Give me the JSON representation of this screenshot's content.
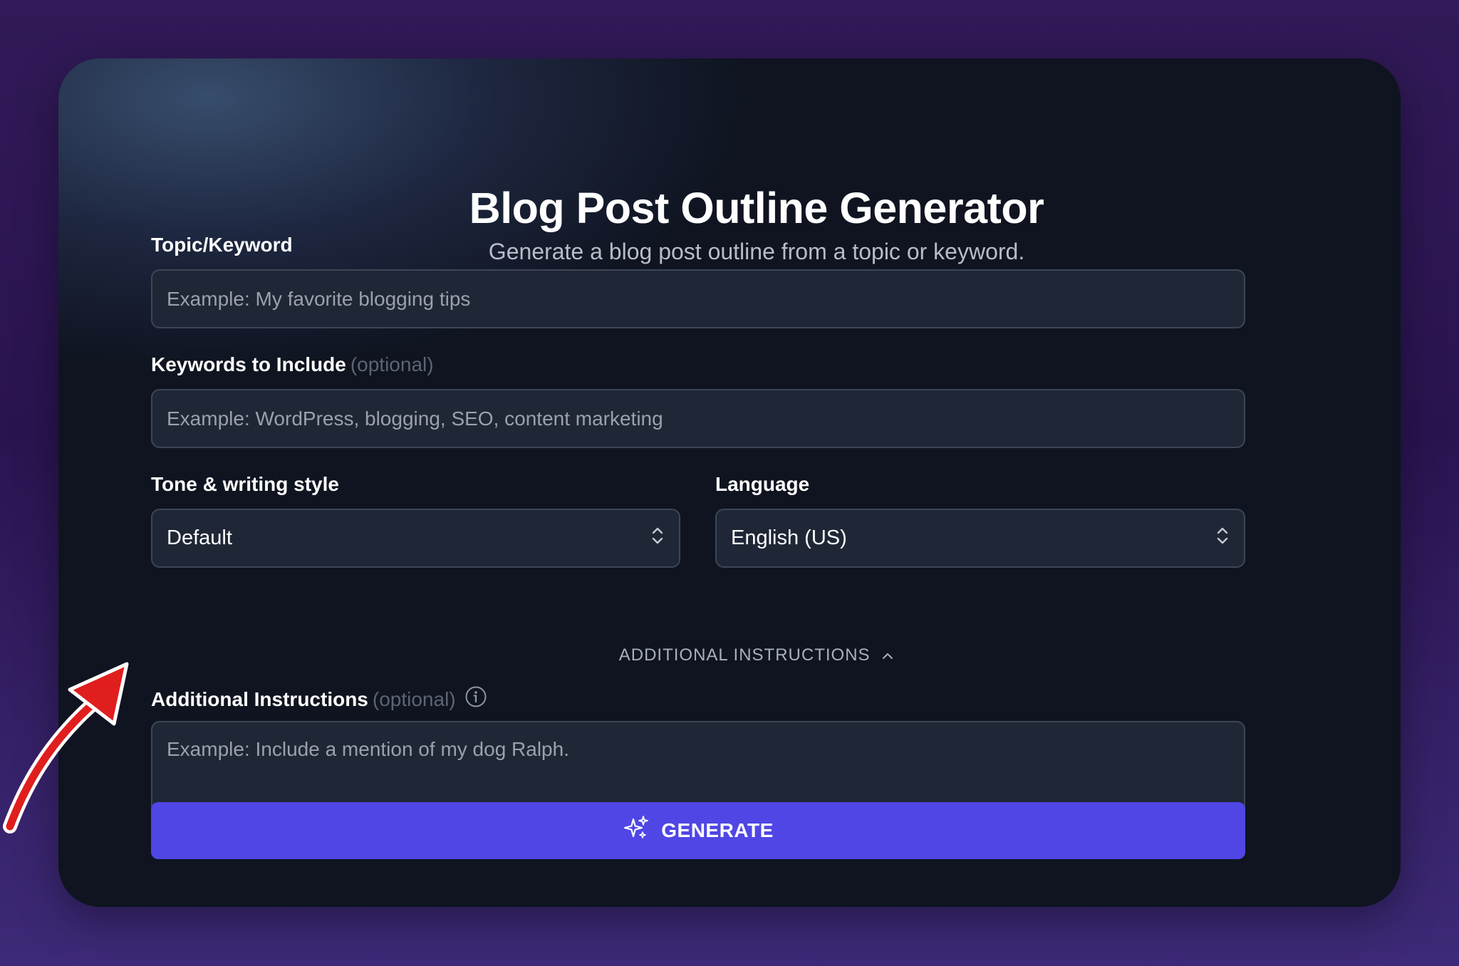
{
  "header": {
    "title": "Blog Post Outline Generator",
    "subtitle": "Generate a blog post outline from a topic or keyword."
  },
  "form": {
    "topic": {
      "label": "Topic/Keyword",
      "placeholder": "Example: My favorite blogging tips",
      "value": ""
    },
    "keywords": {
      "label": "Keywords to Include",
      "optional_label": "(optional)",
      "placeholder": "Example: WordPress, blogging, SEO, content marketing",
      "value": ""
    },
    "tone": {
      "label": "Tone & writing style",
      "selected": "Default"
    },
    "language": {
      "label": "Language",
      "selected": "English (US)"
    },
    "additional_toggle": {
      "label": "ADDITIONAL INSTRUCTIONS",
      "expanded": true
    },
    "additional": {
      "label": "Additional Instructions",
      "optional_label": "(optional)",
      "placeholder": "Example: Include a mention of my dog Ralph.",
      "value": ""
    },
    "generate_button": {
      "label": "GENERATE"
    }
  },
  "icons": {
    "generate": "sparkles-icon",
    "info": "info-icon",
    "select": "chevron-up-down-icon",
    "toggle": "chevron-up-icon",
    "annotation": "arrow-annotation-icon"
  },
  "colors": {
    "background": "#2a1450",
    "card": "#0f1420",
    "input_bg": "#1f2736",
    "input_border": "#3d4656",
    "accent": "#4f46e5",
    "annotation_arrow": "#e01e1e"
  }
}
